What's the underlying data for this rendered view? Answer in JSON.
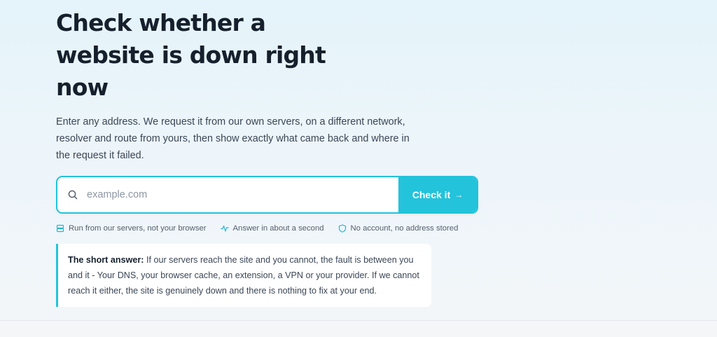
{
  "hero": {
    "title": "Check whether a website is down right now",
    "lead": "Enter any address. We request it from our own servers, on a different network, resolver and route from yours, then show exactly what came back and where in the request it failed."
  },
  "search": {
    "placeholder": "example.com",
    "value": "",
    "button_label": "Check it",
    "button_arrow": "→"
  },
  "features": [
    {
      "icon": "server-icon",
      "label": "Run from our servers, not your browser"
    },
    {
      "icon": "activity-icon",
      "label": "Answer in about a second"
    },
    {
      "icon": "shield-icon",
      "label": "No account, no address stored"
    }
  ],
  "short_answer": {
    "heading": "The short answer:",
    "body": "If our servers reach the site and you cannot, the fault is between you and it - Your DNS, your browser cache, an extension, a VPN or your provider. If we cannot reach it either, the site is genuinely down and there is nothing to fix at your end."
  },
  "colors": {
    "accent": "#23c3db",
    "heading": "#16202c",
    "text": "#3b4656"
  }
}
